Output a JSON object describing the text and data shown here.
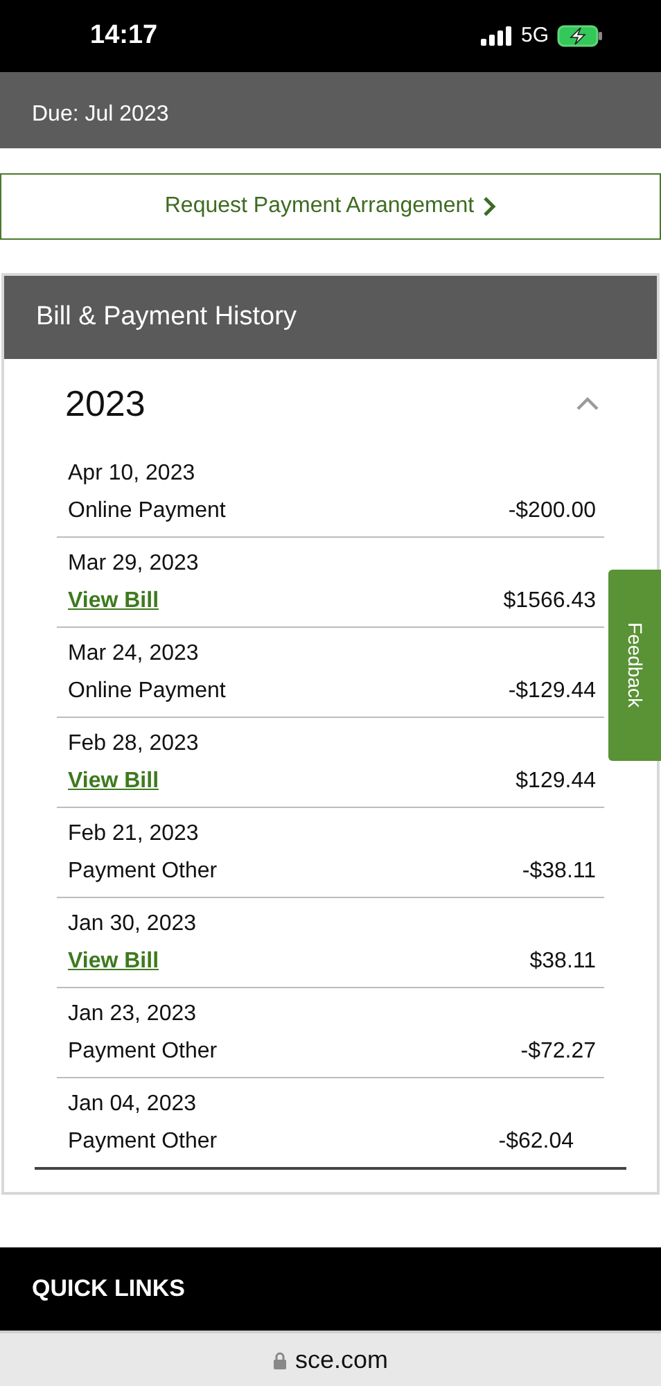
{
  "status_bar": {
    "time": "14:17",
    "network": "5G"
  },
  "due": "Due: Jul 2023",
  "arrangement_button": {
    "label": "Request Payment Arrangement"
  },
  "history": {
    "title": "Bill & Payment History",
    "year": {
      "label": "2023",
      "expanded": true,
      "rows": [
        {
          "date": "Apr 10, 2023",
          "kind": "payment",
          "label": "Online Payment",
          "amount": "-$200.00"
        },
        {
          "date": "Mar 29, 2023",
          "kind": "bill",
          "label": "View Bill",
          "amount": "$1566.43"
        },
        {
          "date": "Mar 24, 2023",
          "kind": "payment",
          "label": "Online Payment",
          "amount": "-$129.44"
        },
        {
          "date": "Feb 28, 2023",
          "kind": "bill",
          "label": "View Bill",
          "amount": "$129.44"
        },
        {
          "date": "Feb 21, 2023",
          "kind": "payment",
          "label": "Payment Other",
          "amount": "-$38.11"
        },
        {
          "date": "Jan 30, 2023",
          "kind": "bill",
          "label": "View Bill",
          "amount": "$38.11"
        },
        {
          "date": "Jan 23, 2023",
          "kind": "payment",
          "label": "Payment Other",
          "amount": "-$72.27"
        },
        {
          "date": "Jan 04, 2023",
          "kind": "payment",
          "label": "Payment Other",
          "amount": "-$62.04"
        }
      ]
    }
  },
  "feedback_tab": "Feedback",
  "footer": {
    "title": "QUICK LINKS"
  },
  "browser": {
    "url": "sce.com"
  }
}
